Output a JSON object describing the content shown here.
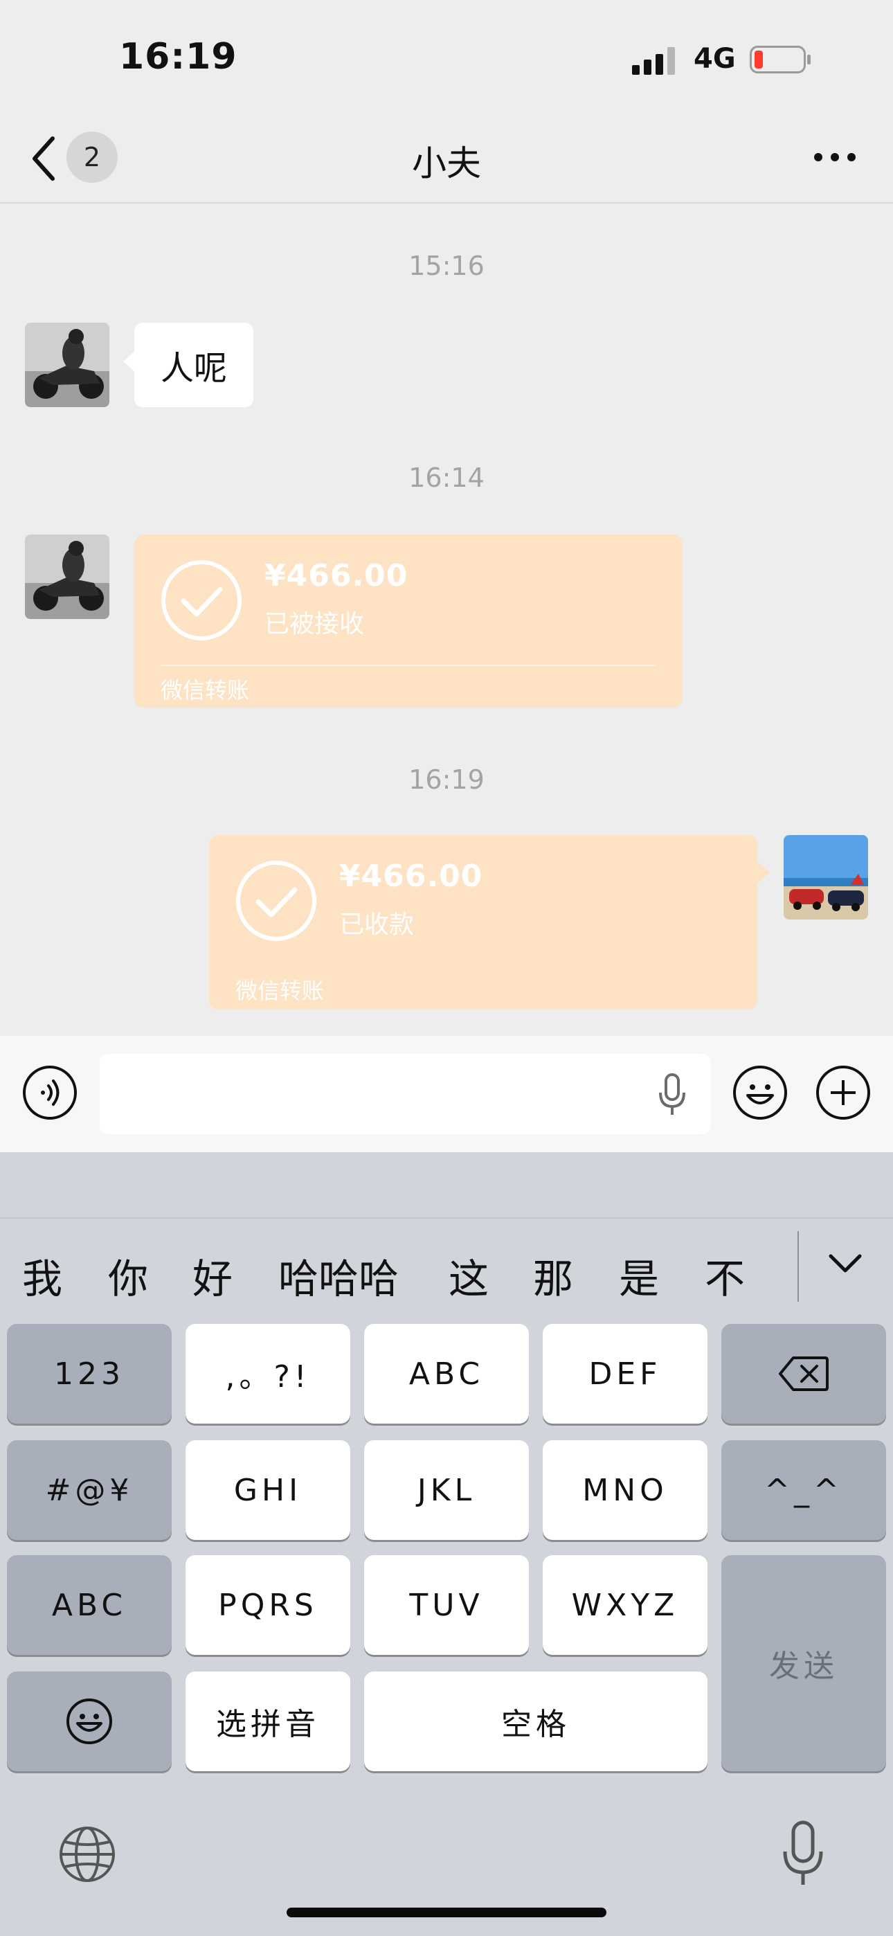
{
  "status_bar": {
    "time": "16:19",
    "network": "4G",
    "battery_level": 0.12
  },
  "nav": {
    "unread_count": "2",
    "title": "小夫"
  },
  "chat": {
    "messages": [
      {
        "timestamp": "15:16",
        "sender": "contact",
        "type": "text",
        "text": "人呢"
      },
      {
        "timestamp": "16:14",
        "sender": "contact",
        "type": "transfer",
        "amount": "¥466.00",
        "status": "已被接收",
        "footer": "微信转账"
      },
      {
        "timestamp": "16:19",
        "sender": "me",
        "type": "transfer",
        "amount": "¥466.00",
        "status": "已收款",
        "footer": "微信转账"
      }
    ]
  },
  "input_bar": {
    "text_value": ""
  },
  "keyboard": {
    "candidates": [
      "我",
      "你",
      "好",
      "哈哈哈",
      "这",
      "那",
      "是",
      "不"
    ],
    "keys": {
      "num": "123",
      "punct": ",。?!",
      "abc2": "ABC",
      "def3": "DEF",
      "sym": "#@¥",
      "ghi4": "GHI",
      "jkl5": "JKL",
      "mno6": "MNO",
      "face": "^_^",
      "abc": "ABC",
      "pqrs7": "PQRS",
      "tuv8": "TUV",
      "wxyz9": "WXYZ",
      "send": "发送",
      "pinyin": "选拼音",
      "space": "空格"
    }
  },
  "colors": {
    "transfer_bubble": "#fde2c4",
    "chat_bg": "#ededed",
    "battery_low": "#ff3b30"
  }
}
